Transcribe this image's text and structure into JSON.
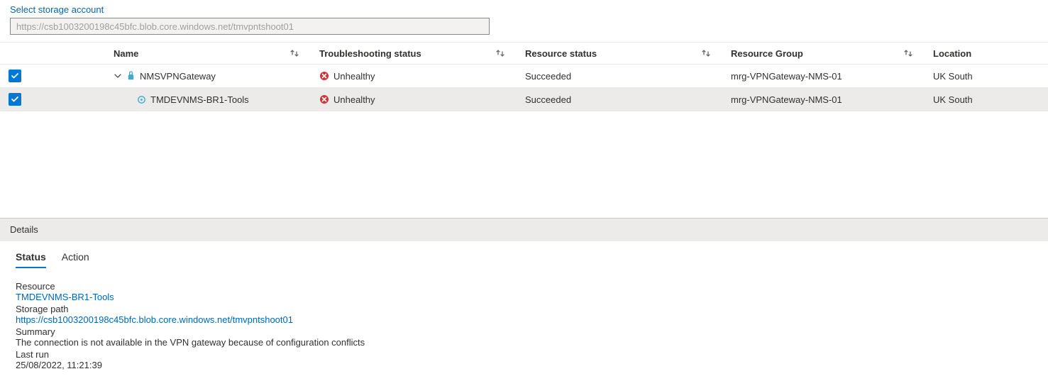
{
  "storage": {
    "select_label": "Select storage account",
    "input_value": "https://csb1003200198c45bfc.blob.core.windows.net/tmvpntshoot01"
  },
  "columns": {
    "name": "Name",
    "troubleshooting_status": "Troubleshooting status",
    "resource_status": "Resource status",
    "resource_group": "Resource Group",
    "location": "Location"
  },
  "rows": [
    {
      "name": "NMSVPNGateway",
      "ts_status": "Unhealthy",
      "r_status": "Succeeded",
      "rg": "mrg-VPNGateway-NMS-01",
      "location": "UK South",
      "type": "gateway",
      "expanded": true,
      "checked": true
    },
    {
      "name": "TMDEVNMS-BR1-Tools",
      "ts_status": "Unhealthy",
      "r_status": "Succeeded",
      "rg": "mrg-VPNGateway-NMS-01",
      "location": "UK South",
      "type": "connection",
      "checked": true,
      "selected": true
    }
  ],
  "details": {
    "title": "Details",
    "tabs": {
      "status": "Status",
      "action": "Action"
    },
    "labels": {
      "resource": "Resource",
      "storage_path": "Storage path",
      "summary": "Summary",
      "last_run": "Last run"
    },
    "resource": "TMDEVNMS-BR1-Tools",
    "storage_path": "https://csb1003200198c45bfc.blob.core.windows.net/tmvpntshoot01",
    "summary": "The connection is not available in the VPN gateway because of configuration conflicts",
    "last_run": "25/08/2022, 11:21:39"
  }
}
